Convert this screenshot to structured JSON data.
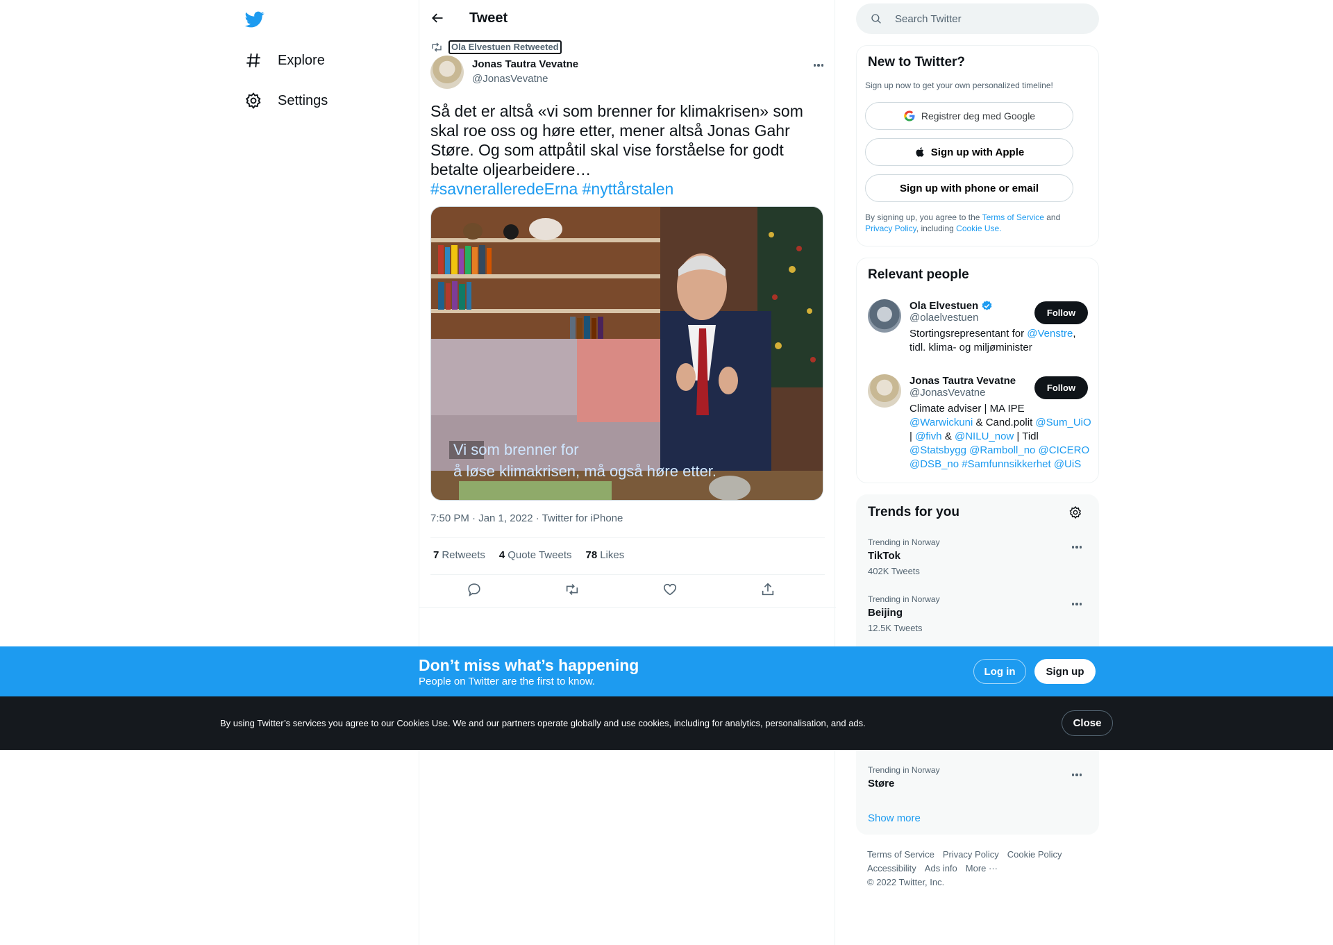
{
  "nav": {
    "items": [
      {
        "label": "Explore",
        "icon": "hashtag-icon"
      },
      {
        "label": "Settings",
        "icon": "gear-icon"
      }
    ]
  },
  "header": {
    "title": "Tweet"
  },
  "tweet": {
    "retweeted_by": "Ola Elvestuen Retweeted",
    "author_name": "Jonas Tautra Vevatne",
    "author_handle": "@JonasVevatne",
    "text": "Så det er altså «vi som brenner for klimakrisen» som skal roe oss og høre etter, mener altså Jonas Gahr Støre. Og som attpåtil skal vise forståelse for godt betalte oljearbeidere…",
    "hashtags": [
      "#savneralleredeErna",
      "#nyttårstalen"
    ],
    "media_caption_line1": "Vi som brenner for",
    "media_caption_line2": "å løse klimakrisen, må også høre etter.",
    "meta": "7:50 PM · Jan 1, 2022 · Twitter for iPhone",
    "stats": [
      {
        "count": "7",
        "label": "Retweets"
      },
      {
        "count": "4",
        "label": "Quote Tweets"
      },
      {
        "count": "78",
        "label": "Likes"
      }
    ],
    "actions": [
      "reply-icon",
      "retweet-icon",
      "like-icon",
      "share-icon"
    ]
  },
  "search": {
    "placeholder": "Search Twitter"
  },
  "signup_card": {
    "title": "New to Twitter?",
    "subtitle": "Sign up now to get your own personalized timeline!",
    "google": "Registrer deg med Google",
    "apple": "Sign up with Apple",
    "phone": "Sign up with phone or email",
    "legal_prefix": "By signing up, you agree to the ",
    "tos": "Terms of Service",
    "and": " and",
    "privacy": "Privacy Policy",
    "including": ", including ",
    "cookie": "Cookie Use."
  },
  "relevant": {
    "title": "Relevant people",
    "follow": "Follow",
    "people": [
      {
        "name": "Ola Elvestuen",
        "verified": true,
        "handle": "@olaelvestuen",
        "bio_a": "Stortingsrepresentant for ",
        "bio_link": "@Venstre",
        "bio_b": ",",
        "bio_c": "tidl. klima- og miljøminister"
      },
      {
        "name": "Jonas Tautra Vevatne",
        "verified": false,
        "handle": "@JonasVevatne",
        "bio_1": "Climate adviser | MA IPE",
        "bio_2a": "@Warwickuni",
        "bio_2b": " & Cand.polit ",
        "bio_2c": "@Sum_UiO",
        "bio_3a": "| ",
        "bio_3b": "@fivh",
        "bio_3c": " & ",
        "bio_3d": "@NILU_now",
        "bio_3e": " | Tidl",
        "bio_4": "@Statsbygg @Ramboll_no @CICERO",
        "bio_5": "@DSB_no #Samfunnsikkerhet @UiS"
      }
    ]
  },
  "trends": {
    "title": "Trends for you",
    "items": [
      {
        "context": "Trending in Norway",
        "name": "TikTok",
        "count": "402K Tweets"
      },
      {
        "context": "Trending in Norway",
        "name": "Beijing",
        "count": "12.5K Tweets"
      },
      {
        "context": "Trending in Norway",
        "name": "Støre",
        "count": ""
      }
    ],
    "show_more": "Show more"
  },
  "footer": {
    "line1": [
      "Terms of Service",
      "Privacy Policy",
      "Cookie Policy"
    ],
    "line2": [
      "Accessibility",
      "Ads info",
      "More ···"
    ],
    "copyright": "© 2022 Twitter, Inc."
  },
  "bottombar": {
    "title": "Don’t miss what’s happening",
    "subtitle": "People on Twitter are the first to know.",
    "login": "Log in",
    "signup": "Sign up"
  },
  "cookiebar": {
    "text": "By using Twitter’s services you agree to our Cookies Use. We and our partners operate globally and use cookies, including for analytics, personalisation, and ads.",
    "close": "Close"
  },
  "colors": {
    "brand": "#1d9bf0",
    "text": "#0f1419",
    "muted": "#536471",
    "cookie_bg": "#15191e"
  }
}
